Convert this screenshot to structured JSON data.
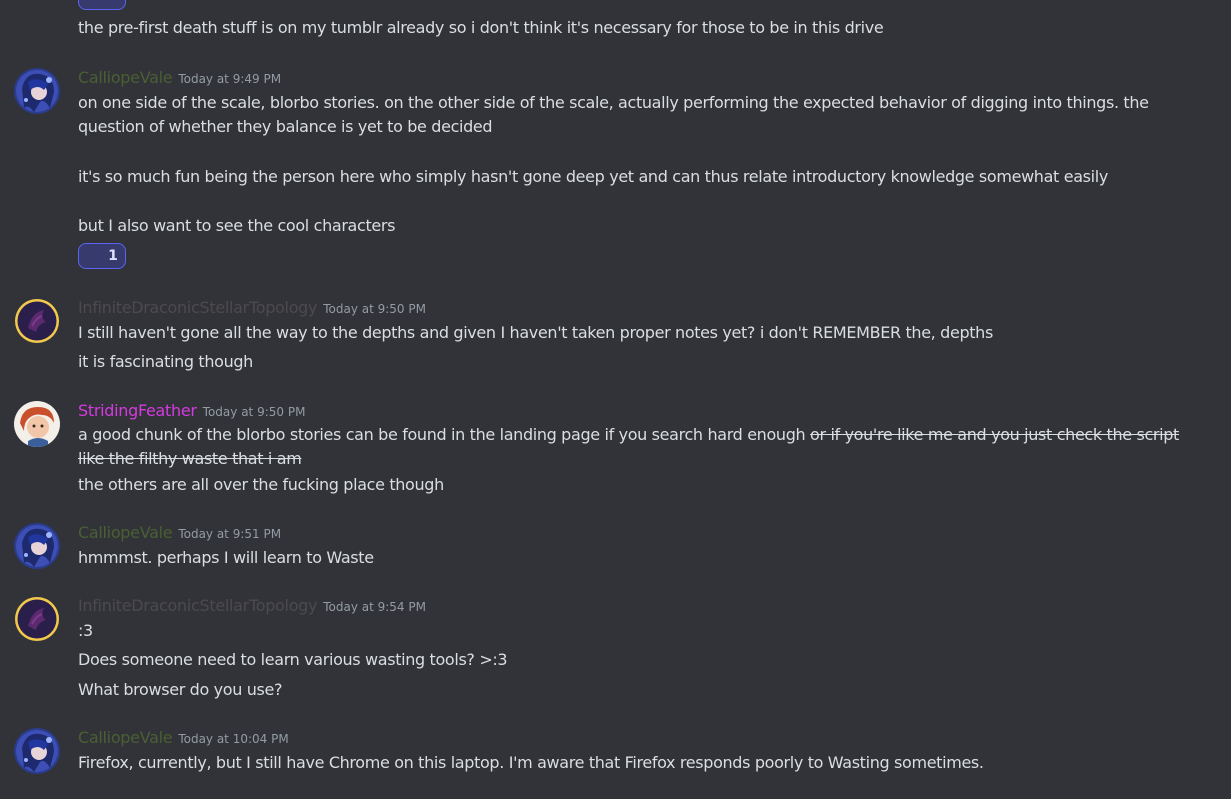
{
  "colors": {
    "background": "#313338",
    "calliope_name": "#4a5f33",
    "infinite_name": "#4d4a4d",
    "striding_name": "#d63ae0",
    "timestamp": "#949ba4",
    "reaction_border": "#5865f2"
  },
  "top": {
    "line1": "the pre-first death stuff is on my tumblr already so i don't think it's necessary for those to be in this drive"
  },
  "msg1": {
    "author": "CalliopeVale",
    "time": "Today at 9:49 PM",
    "line1": "on one side of the scale, blorbo stories. on the other side of the scale, actually performing the expected behavior of digging into things. the question of whether they balance is yet to be decided",
    "line2": "it's so much fun being the person here who simply hasn't gone deep yet and can thus relate introductory knowledge somewhat easily",
    "line3": "but I also want to see the cool characters",
    "reaction": {
      "icon": "crescent-moon-icon",
      "count": "1"
    }
  },
  "msg2": {
    "author": "InfiniteDraconicStellarTopology",
    "time": "Today at 9:50 PM",
    "line1": "I still haven't gone all the way to the depths and given I haven't taken proper notes yet? i don't REMEMBER the, depths",
    "line2": "it is fascinating though"
  },
  "msg3": {
    "author": "StridingFeather",
    "time": "Today at 9:50 PM",
    "line1_plain": "a good chunk of the blorbo stories can be found in the landing page if you search hard enough ",
    "line1_strike": "or if you're like me and you just check the script like the filthy waste that i am",
    "line2": "the others are all over the fucking place though"
  },
  "msg4": {
    "author": "CalliopeVale",
    "time": "Today at 9:51 PM",
    "line1": "hmmmst. perhaps I will learn to Waste"
  },
  "msg5": {
    "author": "InfiniteDraconicStellarTopology",
    "time": "Today at 9:54 PM",
    "line1": ":3",
    "line2": "Does someone need to learn various wasting tools? >:3",
    "line3": "What browser do you use?"
  },
  "msg6": {
    "author": "CalliopeVale",
    "time": "Today at 10:04 PM",
    "line1": "Firefox, currently, but I still have Chrome on this laptop. I'm aware that Firefox responds poorly to Wasting sometimes."
  }
}
